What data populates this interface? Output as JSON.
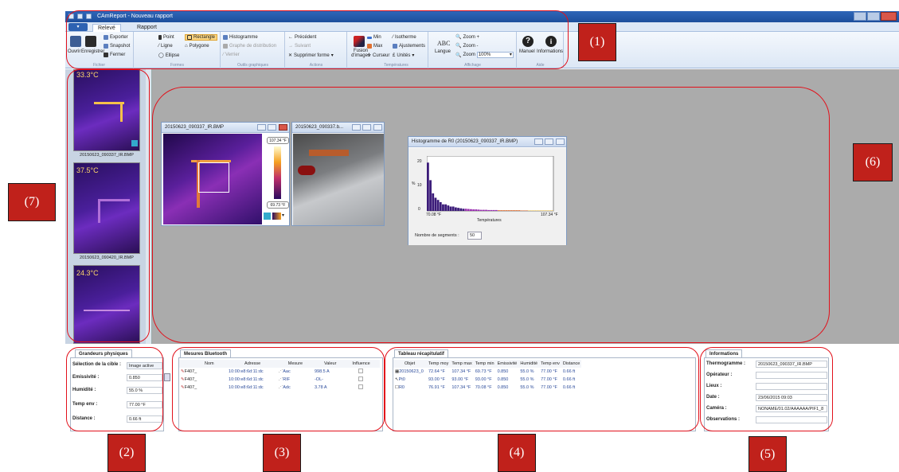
{
  "window": {
    "title": "CAmReport - Nouveau rapport"
  },
  "tabs": [
    {
      "label": "Relevé",
      "active": true
    },
    {
      "label": "Rapport",
      "active": false
    }
  ],
  "ribbon": {
    "fichier": {
      "ouvrir": "Ouvrir",
      "enregistrer": "Enregistrer",
      "exporter": "Exporter",
      "snapshot": "Snapshot",
      "fermer": "Fermer",
      "group": "Fichier"
    },
    "formes": {
      "point": "Point",
      "rectangle": "Rectangle",
      "ligne": "Ligne",
      "polygone": "Polygone",
      "ellipse": "Ellipse",
      "group": "Formes"
    },
    "outils": {
      "histogramme": "Histogramme",
      "graphe": "Graphe de distribution",
      "verrier": "Verrier",
      "group": "Outils graphiques"
    },
    "actions": {
      "precedent": "Précédent",
      "suivant": "Suivant",
      "supprimer": "Supprimer forme",
      "group": "Actions"
    },
    "fusion": {
      "label": "Fusion d'images"
    },
    "temperatures": {
      "min": "Min",
      "max": "Max",
      "curseur": "Curseur",
      "isotherme": "Isotherme",
      "ajustements": "Ajustements",
      "unites": "Unités",
      "group": "Températures"
    },
    "affichage": {
      "langue": "Langue",
      "abc": "ABC",
      "zoom_plus": "Zoom +",
      "zoom_moins": "Zoom -",
      "zoom": "Zoom",
      "zoom_value": "100%",
      "group": "Affichage"
    },
    "aide": {
      "manuel": "Manuel",
      "informations": "Informations",
      "group": "Aide"
    }
  },
  "thumbnails": [
    {
      "temp": "33.3°C",
      "caption": "20150623_090337_IR.BMP"
    },
    {
      "temp": "37.5°C",
      "caption": "20150623_090420_IR.BMP"
    },
    {
      "temp": "24.3°C",
      "caption": ""
    }
  ],
  "ir_window": {
    "title": "20150623_090337_IR.BMP",
    "max": "107.34 °F",
    "min": "69.73 °F"
  },
  "photo_window": {
    "title": "20150623_090337.b..."
  },
  "hist_window": {
    "title": "Histogramme de R0 (20150623_090337_IR.BMP)",
    "ylabel": "%",
    "yticks": [
      "20",
      "10",
      "0"
    ],
    "xmin": "70.08 °F",
    "xmax": "107.34 °F",
    "xlabel": "Températures",
    "segments_label": "Nombre de segments :",
    "segments_value": "50"
  },
  "grandeurs": {
    "tab": "Grandeurs physiques",
    "selection_label": "Sélection de la cible :",
    "selection_value": "Image active",
    "emissivite_label": "Emissivité :",
    "emissivite_value": "0.850",
    "humidite_label": "Humidité :",
    "humidite_value": "55.0 %",
    "temp_label": "Temp env :",
    "temp_value": "77.00 °F",
    "distance_label": "Distance :",
    "distance_value": "0.66 ft"
  },
  "bluetooth": {
    "tab": "Mesures Bluetooth",
    "headers": [
      "Nom",
      "Adresse",
      "Mesure",
      "Valeur",
      "Influence"
    ],
    "rows": [
      [
        "F407_",
        "10:00:e8:6d:11:dc",
        "Aac",
        "998.5 A"
      ],
      [
        "F407_",
        "10:00:e8:6d:11:dc",
        "RIF",
        "-OL-"
      ],
      [
        "F407_",
        "10:00:e8:6d:11:dc",
        "Adc",
        "3.78 A"
      ]
    ]
  },
  "tableau": {
    "tab": "Tableau récapitulatif",
    "headers": [
      "Objet",
      "Temp moy",
      "Temp max",
      "Temp min",
      "Emissivité",
      "Humidité",
      "Temp env",
      "Distance"
    ],
    "rows": [
      [
        "20150623_0",
        "72.64 °F",
        "107.34 °F",
        "69.73 °F",
        "0.850",
        "55.0 %",
        "77.00 °F",
        "0.66 ft"
      ],
      [
        "Pt0",
        "93.00 °F",
        "93.00 °F",
        "93.00 °F",
        "0.850",
        "55.0 %",
        "77.00 °F",
        "0.66 ft"
      ],
      [
        "R0",
        "76.91 °F",
        "107.34 °F",
        "70.08 °F",
        "0.850",
        "55.0 %",
        "77.00 °F",
        "0.66 ft"
      ]
    ]
  },
  "informations": {
    "tab": "Informations",
    "thermogramme_label": "Thermogramme :",
    "thermogramme_value": "20150623_090337_IR.BMP",
    "operateur_label": "Opérateur :",
    "lieux_label": "Lieux :",
    "date_label": "Date :",
    "date_value": "23/06/2015 09:03",
    "camera_label": "Caméra :",
    "camera_value": "NONAME/01.02/AAAAAA/PIF1_8",
    "observations_label": "Observations :"
  },
  "callouts": [
    "(1)",
    "(2)",
    "(3)",
    "(4)",
    "(5)",
    "(6)",
    "(7)"
  ],
  "colors": {
    "callout_red": "#e2111b",
    "callout_fill": "#c0211b",
    "ribbon_blue": "#2f66b8"
  }
}
